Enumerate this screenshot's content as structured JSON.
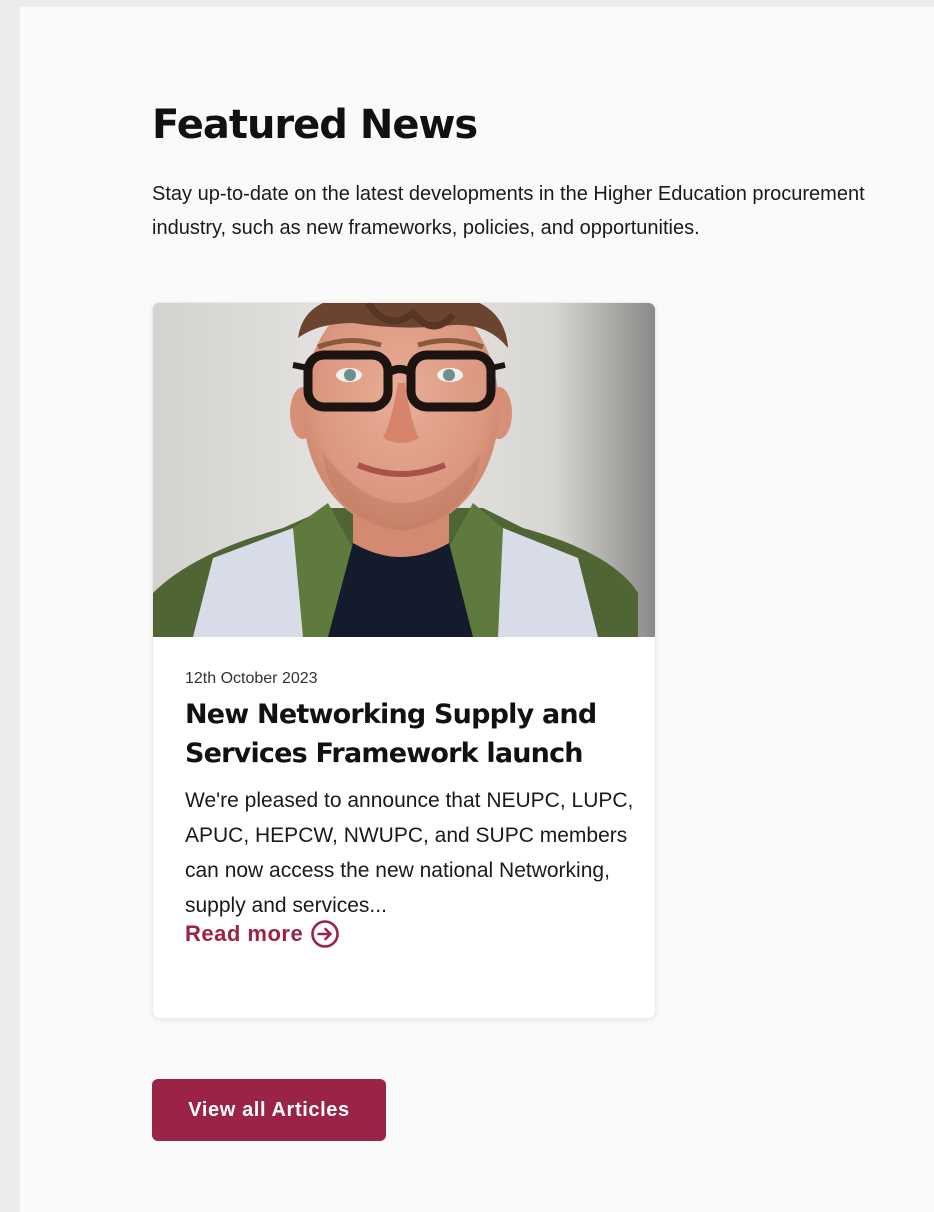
{
  "section": {
    "title": "Featured News",
    "intro": "Stay up-to-date on the latest developments in the Higher Education procurement industry, such as new frameworks, policies, and opportunities."
  },
  "articles": [
    {
      "date": "12th October 2023",
      "title": "New Networking Supply and Services Framework launch",
      "excerpt": "We're pleased to announce that NEUPC, LUPC, APUC, HEPCW, NWUPC, and SUPC members can now access the new national Networking, supply and services...",
      "read_more_label": "Read more",
      "image_alt": "Portrait of a smiling man with curly hair and glasses wearing a green jacket"
    }
  ],
  "actions": {
    "view_all_label": "View all Articles"
  },
  "colors": {
    "accent": "#9b2345",
    "page_background": "#fafafa",
    "outer_background": "#ececec"
  },
  "icons": {
    "read_more": "arrow-right-circle-icon"
  }
}
